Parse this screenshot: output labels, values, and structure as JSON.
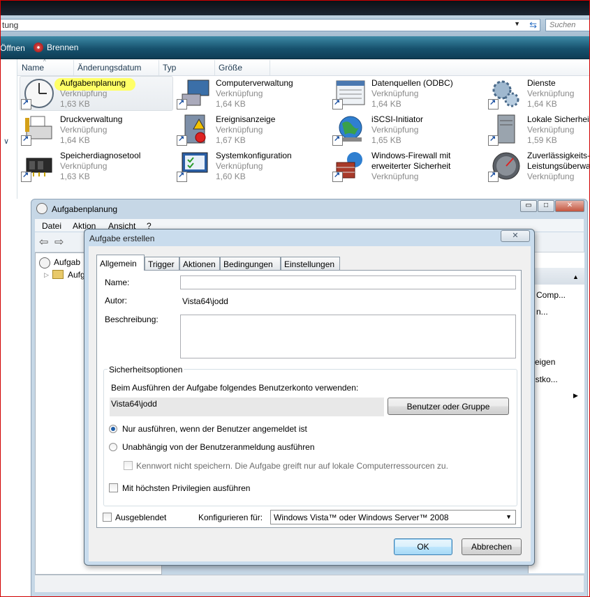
{
  "explorer": {
    "address_text": "tung",
    "search_placeholder": "Suchen",
    "commands": {
      "open": "Öffnen",
      "burn": "Brennen"
    },
    "columns": [
      "Name",
      "Änderungsdatum",
      "Typ",
      "Größe"
    ],
    "items": [
      {
        "name": "Aufgabenplanung",
        "type": "Verknüpfung",
        "size": "1,63 KB",
        "icon": "clock-icon"
      },
      {
        "name": "Computerverwaltung",
        "type": "Verknüpfung",
        "size": "1,64 KB",
        "icon": "computer-management-icon"
      },
      {
        "name": "Datenquellen (ODBC)",
        "type": "Verknüpfung",
        "size": "1,64 KB",
        "icon": "database-icon"
      },
      {
        "name": "Dienste",
        "type": "Verknüpfung",
        "size": "1,64 KB",
        "icon": "gears-icon"
      },
      {
        "name": "Druckverwaltung",
        "type": "Verknüpfung",
        "size": "1,64 KB",
        "icon": "printer-icon"
      },
      {
        "name": "Ereignisanzeige",
        "type": "Verknüpfung",
        "size": "1,67 KB",
        "icon": "event-viewer-icon"
      },
      {
        "name": "iSCSI-Initiator",
        "type": "Verknüpfung",
        "size": "1,65 KB",
        "icon": "globe-icon"
      },
      {
        "name": "Lokale Sicherheit",
        "type": "Verknüpfung",
        "size": "1,59 KB",
        "icon": "server-icon"
      },
      {
        "name": "Speicherdiagnosetool",
        "type": "Verknüpfung",
        "size": "1,63 KB",
        "icon": "memory-chip-icon"
      },
      {
        "name": "Systemkonfiguration",
        "type": "Verknüpfung",
        "size": "1,60 KB",
        "icon": "system-config-icon"
      },
      {
        "name": "Windows-Firewall mit",
        "name2": "erweiterter Sicherheit",
        "type": "Verknüpfung",
        "icon": "firewall-icon"
      },
      {
        "name": "Zuverlässigkeits-",
        "name2": "Leistungsüberwa",
        "type": "Verknüpfung",
        "icon": "gauge-icon"
      }
    ]
  },
  "mmc": {
    "title": "Aufgabenplanung",
    "menu": [
      "Datei",
      "Aktion",
      "Ansicht",
      "?"
    ],
    "tree": [
      "Aufgab",
      "Aufg"
    ],
    "actions": [
      "Comp...",
      "n...",
      "zeigen",
      "nstko..."
    ]
  },
  "dialog": {
    "title": "Aufgabe erstellen",
    "close_label": "✕",
    "tabs": [
      "Allgemein",
      "Trigger",
      "Aktionen",
      "Bedingungen",
      "Einstellungen"
    ],
    "name_label": "Name:",
    "name_value": "",
    "author_label": "Autor:",
    "author_value": "Vista64\\jodd",
    "description_label": "Beschreibung:",
    "description_value": "",
    "security_group": "Sicherheitsoptionen",
    "security_account_text": "Beim Ausführen der Aufgabe folgendes Benutzerkonto verwenden:",
    "security_account_value": "Vista64\\jodd",
    "user_group_button": "Benutzer oder Gruppe",
    "radio_logged_on": "Nur ausführen, wenn der Benutzer angemeldet ist",
    "radio_independent": "Unabhängig von der Benutzeranmeldung ausführen",
    "no_store_password": "Kennwort nicht speichern. Die Aufgabe greift nur auf lokale Computerressourcen zu.",
    "highest_privileges": "Mit höchsten Privilegien ausführen",
    "hidden": "Ausgeblendet",
    "configure_for_label": "Konfigurieren für:",
    "configure_for_value": "Windows Vista™ oder Windows Server™ 2008",
    "ok": "OK",
    "cancel": "Abbrechen"
  },
  "colors": {
    "highlight": "#ffff66",
    "frame": "#d00000",
    "accent": "#1e5ea8"
  }
}
